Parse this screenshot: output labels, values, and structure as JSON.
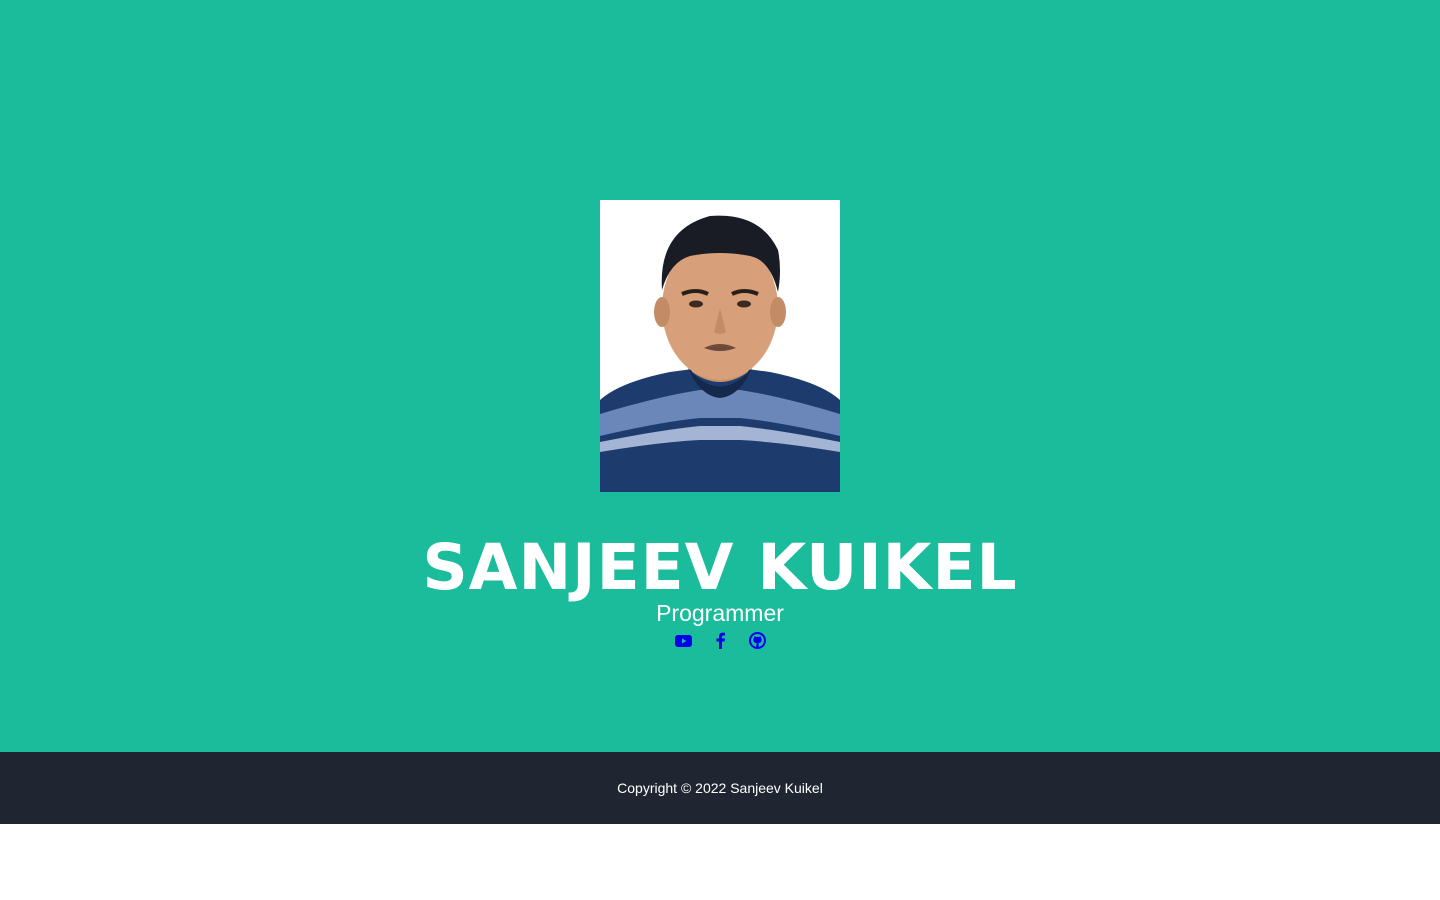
{
  "profile": {
    "name": "SANJEEV KUIKEL",
    "title": "Programmer",
    "photo_alt": "profile-photo"
  },
  "socials": [
    {
      "icon": "youtube-icon"
    },
    {
      "icon": "facebook-icon"
    },
    {
      "icon": "github-icon"
    }
  ],
  "footer": {
    "copyright": "Copyright © 2022 Sanjeev Kuikel"
  },
  "colors": {
    "masthead_bg": "#1abc9c",
    "footer_bg": "#1f2631",
    "link": "#0000ee"
  }
}
